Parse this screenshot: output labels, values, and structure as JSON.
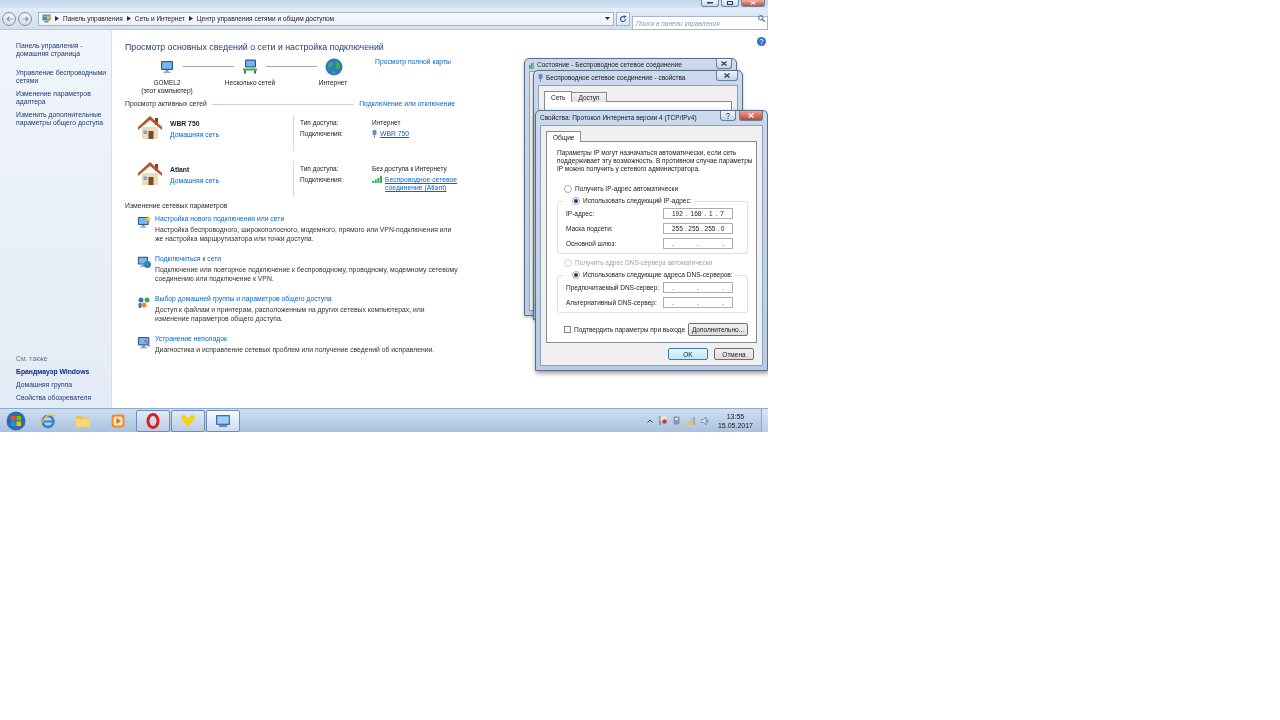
{
  "address_bar": {
    "path": [
      "Панель управления",
      "Сеть и Интернет",
      "Центр управления сетями и общим доступом"
    ]
  },
  "search": {
    "placeholder": "Поиск в панели управления"
  },
  "sidebar": {
    "links": [
      "Панель управления - домашняя страница",
      "Управление беспроводными сетями",
      "Изменение параметров адаптера",
      "Изменить дополнительные параметры общего доступа"
    ],
    "see_also": {
      "title": "См. также",
      "links": [
        {
          "label": "Брандмауэр Windows",
          "hovered": true
        },
        {
          "label": "Домашняя группа",
          "hovered": false
        },
        {
          "label": "Свойства обозревателя",
          "hovered": false
        }
      ]
    }
  },
  "main": {
    "title": "Просмотр основных сведений о сети и настройка подключений",
    "map": {
      "nodes": [
        {
          "kind": "computer",
          "name": "GOMEL2",
          "note": "(этот компьютер)"
        },
        {
          "kind": "networks",
          "name": "Несколько сетей"
        },
        {
          "kind": "internet",
          "name": "Интернет"
        }
      ],
      "full_map_link": "Просмотр полной карты"
    },
    "active_networks": {
      "title": "Просмотр активных сетей",
      "connect_link": "Подключение или отключение",
      "networks": [
        {
          "name": "WBR 750",
          "category": "Домашняя сеть",
          "access_label": "Тип доступа:",
          "access": "Интернет",
          "connections_label": "Подключения:",
          "connection": {
            "kind": "adapter",
            "label": "WBR 750"
          }
        },
        {
          "name": "Atlant",
          "category": "Домашняя сеть",
          "access_label": "Тип доступа:",
          "access": "Без доступа к Интернету",
          "connections_label": "Подключения:",
          "connection": {
            "kind": "wireless",
            "label": "Беспроводное сетевое соединение (Atlant)"
          }
        }
      ]
    },
    "change_settings": {
      "title": "Изменение сетевых параметров",
      "tasks": [
        {
          "kind": "new-connection",
          "title": "Настройка нового подключения или сети",
          "description": "Настройка беспроводного, широкополосного, модемного, прямого или VPN-подключения или же настройка маршрутизатора или точки доступа."
        },
        {
          "kind": "connect",
          "title": "Подключиться к сети",
          "description": "Подключение или повторное подключение к беспроводному, проводному, модемному сетевому соединению или подключение к VPN."
        },
        {
          "kind": "homegroup",
          "title": "Выбор домашней группы и параметров общего доступа",
          "description": "Доступ к файлам и принтерам, расположенным на других сетевых компьютерах, или изменение параметров общего доступа."
        },
        {
          "kind": "troubleshoot",
          "title": "Устранение неполадок",
          "description": "Диагностика и исправление сетевых проблем или получение сведений об исправлении."
        }
      ]
    }
  },
  "status_window": {
    "title": "Состояние - Беспроводное сетевое соединение"
  },
  "properties_window": {
    "title": "Беспроводное сетевое соединение - свойства",
    "tabs": [
      {
        "label": "Сеть",
        "selected": true
      },
      {
        "label": "Доступ",
        "selected": false
      }
    ]
  },
  "ipv4_dialog": {
    "title": "Свойства: Протокол Интернета версии 4 (TCP/IPv4)",
    "tabs": [
      {
        "label": "Общие",
        "selected": true
      }
    ],
    "intro": "Параметры IP могут назначаться автоматически, если сеть поддерживает эту возможность. В противном случае параметры IP можно получить у сетевого администратора.",
    "ip_options": [
      {
        "label": "Получить IP-адрес автоматически",
        "selected": false,
        "disabled": false
      },
      {
        "label": "Использовать следующий IP-адрес:",
        "selected": true,
        "disabled": false
      }
    ],
    "ip_fields": [
      {
        "label": "IP-адрес:",
        "value": "192 . 168 . 1 . 7"
      },
      {
        "label": "Маска подсети:",
        "value": "255 . 255 . 255 . 0"
      },
      {
        "label": "Основной шлюз:",
        "value": ". . ."
      }
    ],
    "dns_options": [
      {
        "label": "Получить адрес DNS-сервера автоматически",
        "selected": false,
        "disabled": true
      },
      {
        "label": "Использовать следующие адреса DNS-серверов:",
        "selected": true,
        "disabled": false
      }
    ],
    "dns_fields": [
      {
        "label": "Предпочитаемый DNS-сервер:",
        "value": ". . ."
      },
      {
        "label": "Альтернативный DNS-сервер:",
        "value": ". . ."
      }
    ],
    "validate": {
      "label": "Подтвердить параметры при выходе",
      "checked": false
    },
    "advanced_button": "Дополнительно...",
    "buttons": [
      {
        "label": "OK",
        "default": true
      },
      {
        "label": "Отмена",
        "default": false
      }
    ]
  },
  "taskbar": {
    "apps": [
      {
        "kind": "browser",
        "running": false,
        "selected": false
      },
      {
        "kind": "folder",
        "running": false,
        "selected": false
      },
      {
        "kind": "media",
        "running": false,
        "selected": false
      },
      {
        "kind": "opera",
        "running": true,
        "selected": false
      },
      {
        "kind": "heart",
        "running": true,
        "selected": false
      },
      {
        "kind": "network",
        "running": true,
        "selected": true
      }
    ],
    "clock": {
      "time": "13:55",
      "date": "15.05.2017"
    }
  }
}
